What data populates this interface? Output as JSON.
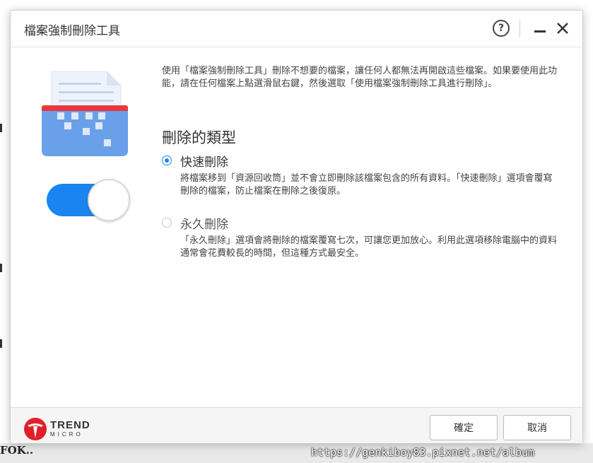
{
  "window": {
    "title": "檔案強制刪除工具"
  },
  "titlebar_buttons": {
    "help_glyph": "?",
    "minimize_icon": "minimize-icon",
    "close_icon": "close-icon"
  },
  "intro_text": "使用「檔案強制刪除工具」刪除不想要的檔案，讓任何人都無法再開啟這些檔案。如果要使用此功能，請在任何檔案上點選滑鼠右鍵，然後選取「使用檔案強制刪除工具進行刪除」。",
  "section_title": "刪除的類型",
  "options": [
    {
      "label": "快速刪除",
      "selected": true,
      "description": "將檔案移到「資源回收筒」並不會立即刪除該檔案包含的所有資料。「快速刪除」選項會覆寫刪除的檔案，防止檔案在刪除之後復原。"
    },
    {
      "label": "永久刪除",
      "selected": false,
      "description": "「永久刪除」選項會將刪除的檔案覆寫七次，可讓您更加放心。利用此選項移除電腦中的資料通常會花費較長的時間，但這種方式最安全。"
    }
  ],
  "footer": {
    "logo_text": "TREND",
    "logo_sub": "MICRO",
    "ok_label": "確定",
    "cancel_label": "取消"
  },
  "background": {
    "bottom_fragment": "FOK.."
  },
  "watermark": "https://genkiboy83.pixnet.net/album",
  "colors": {
    "accent": "#1a84f0",
    "brand_red": "#e0202a",
    "shredder_blue": "#6aa0ea",
    "shredder_red": "#e8373f"
  }
}
